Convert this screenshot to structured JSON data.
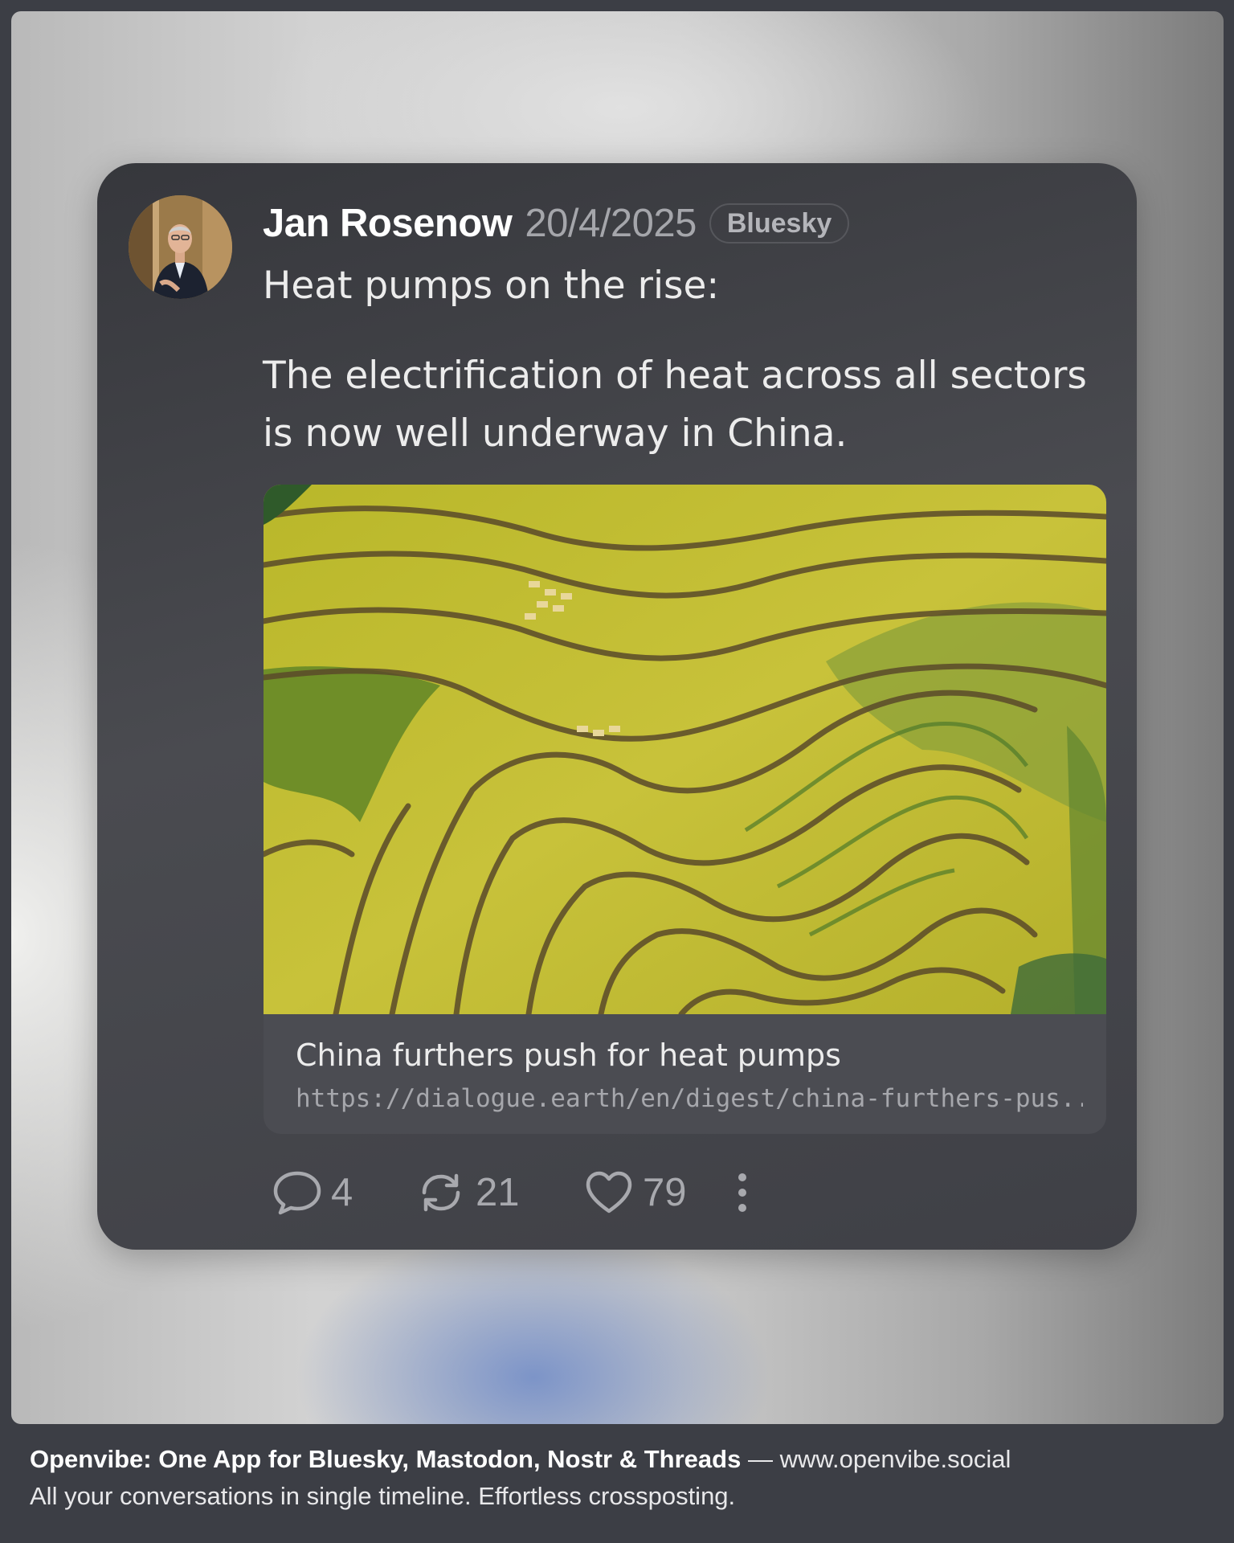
{
  "post": {
    "author": "Jan Rosenow",
    "date": "20/4/2025",
    "network": "Bluesky",
    "text_line1": "Heat pumps on the rise:",
    "text_line2": "The electrification of heat across all sectors is now well underway in China.",
    "link": {
      "title": "China furthers push for heat pumps",
      "url": "https://dialogue.earth/en/digest/china-furthers-pus..."
    },
    "actions": {
      "replies": "4",
      "reposts": "21",
      "likes": "79"
    },
    "icons": {
      "reply": "speech-bubble-icon",
      "repost": "repost-arrows-icon",
      "like": "heart-icon",
      "more": "vertical-ellipsis-icon"
    }
  },
  "footer": {
    "title": "Openvibe: One App for Bluesky, Mastodon, Nostr & Threads",
    "separator": " — ",
    "site": "www.openvibe.social",
    "tagline": "All your conversations in single timeline. Effortless crossposting."
  },
  "colors": {
    "card_background": "#3f4046",
    "author_text": "#ffffff",
    "muted_text": "#a8a9ae",
    "accent_backdrop": "#7891c8"
  }
}
